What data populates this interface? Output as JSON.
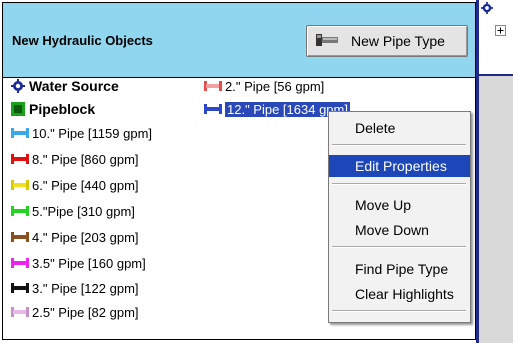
{
  "panel": {
    "title": "New Hydraulic Objects",
    "new_pipe_button": "New Pipe Type"
  },
  "tree": {
    "left": [
      {
        "label": "Water Source",
        "icon": "gear-icon",
        "color": "#1a2a9a"
      },
      {
        "label": "Pipeblock",
        "icon": "pipeblock-icon",
        "color": "#1aa31a"
      },
      {
        "label": "10.\" Pipe [1159 gpm]",
        "icon": "pipe-icon",
        "color": "#3aa9e6"
      },
      {
        "label": "8.\" Pipe [860 gpm]",
        "icon": "pipe-icon",
        "color": "#e01010"
      },
      {
        "label": "6.\" Pipe [440 gpm]",
        "icon": "pipe-icon",
        "color": "#f0e020"
      },
      {
        "label": "5.\"Pipe [310 gpm]",
        "icon": "pipe-icon",
        "color": "#22d322"
      },
      {
        "label": "4.\" Pipe [203 gpm]",
        "icon": "pipe-icon",
        "color": "#8a5020"
      },
      {
        "label": "3.5\" Pipe [160 gpm]",
        "icon": "pipe-icon",
        "color": "#ee22ee"
      },
      {
        "label": "3.\" Pipe [122 gpm]",
        "icon": "pipe-icon",
        "color": "#111111"
      },
      {
        "label": "2.5\" Pipe [82 gpm]",
        "icon": "pipe-icon",
        "color": "#e8b8e8"
      }
    ],
    "right": [
      {
        "label": "2.\" Pipe [56 gpm]",
        "icon": "pipe-icon",
        "color": "#e84a4a"
      },
      {
        "label": "12.\" Pipe [1634 gpm]",
        "icon": "pipe-icon",
        "color": "#2a48c8"
      }
    ]
  },
  "context_menu": {
    "delete": "Delete",
    "edit_properties": "Edit Properties",
    "move_up": "Move Up",
    "move_down": "Move Down",
    "find_pipe_type": "Find Pipe Type",
    "clear_highlights": "Clear Highlights"
  },
  "colors": {
    "header_bg": "#8fd6ee",
    "selection": "#2a48b8",
    "menu_highlight": "#1d47b9"
  }
}
